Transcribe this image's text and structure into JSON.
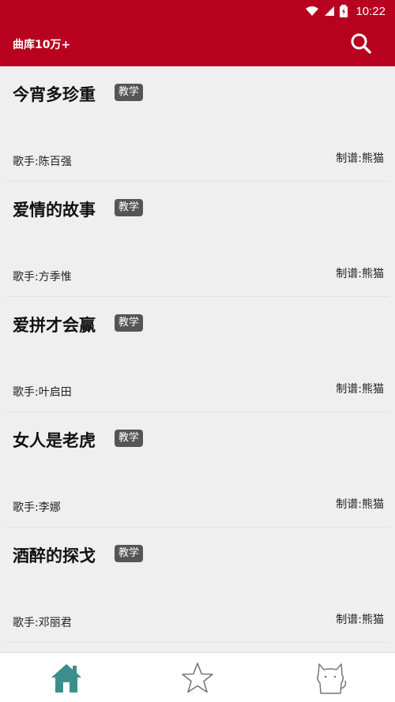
{
  "status_bar": {
    "time": "10:22",
    "icons": [
      "wifi-icon",
      "signal-icon",
      "battery-charging-icon"
    ]
  },
  "app_bar": {
    "title": "曲库10万+",
    "action_icon": "search-icon"
  },
  "songs": [
    {
      "title": "今宵多珍重",
      "badge": "教学",
      "singer": "歌手:陈百强",
      "maker": "制谱:熊猫"
    },
    {
      "title": "爱情的故事",
      "badge": "教学",
      "singer": "歌手:方季惟",
      "maker": "制谱:熊猫"
    },
    {
      "title": "爱拼才会赢",
      "badge": "教学",
      "singer": "歌手:叶启田",
      "maker": "制谱:熊猫"
    },
    {
      "title": "女人是老虎",
      "badge": "教学",
      "singer": "歌手:李娜",
      "maker": "制谱:熊猫"
    },
    {
      "title": "酒醉的探戈",
      "badge": "教学",
      "singer": "歌手:邓丽君",
      "maker": "制谱:熊猫"
    }
  ],
  "bottom_nav": {
    "items": [
      {
        "icon": "home-icon",
        "active": true
      },
      {
        "icon": "star-icon",
        "active": false
      },
      {
        "icon": "cat-icon",
        "active": false
      }
    ]
  },
  "colors": {
    "primary": "#b8001f",
    "background": "#efefef",
    "badge": "#555555",
    "nav_active": "#3a8f8c",
    "nav_inactive": "#777777"
  }
}
